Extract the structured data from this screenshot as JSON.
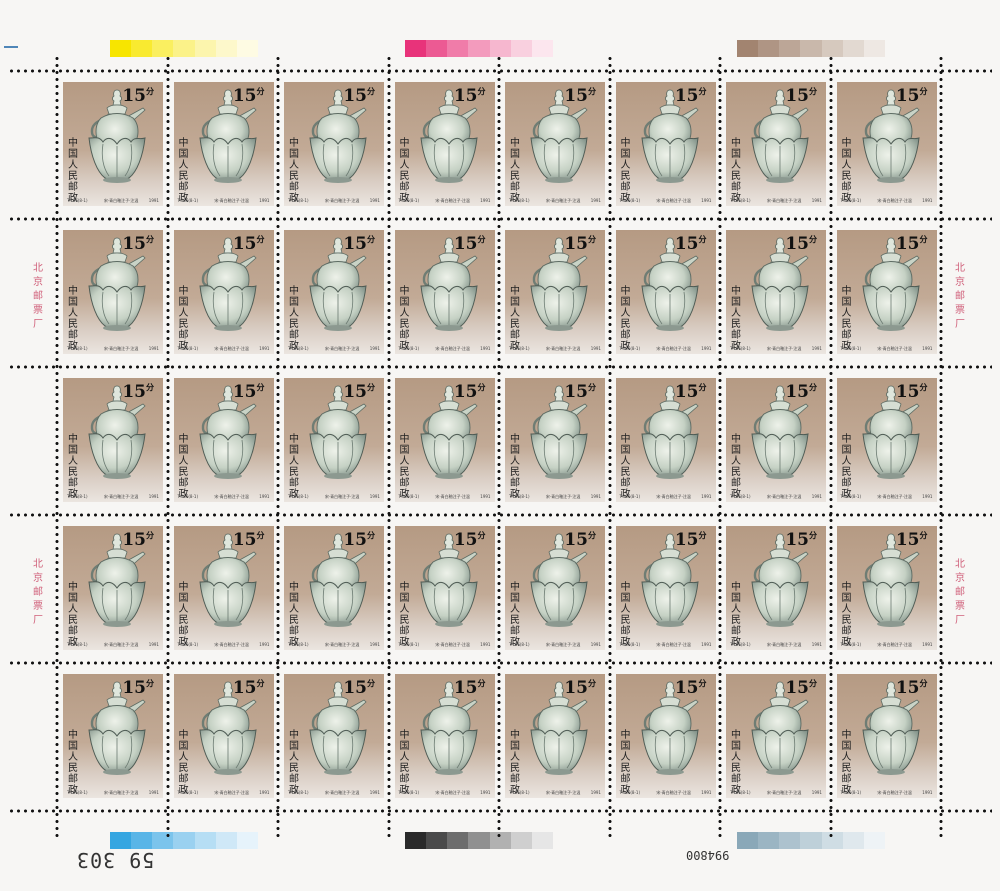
{
  "sheet": {
    "title": "",
    "rows": 5,
    "cols": 8
  },
  "stamp": {
    "denomination": "15",
    "denomination_unit": "分",
    "country": "中国人民邮政",
    "code": "T.166(8-1)",
    "description": "宋·青白釉注子·注温",
    "year": "1991",
    "colors": {
      "background_top": "#b59a83",
      "background_bottom": "#ebe5e0",
      "porcelain": "#c9d3c6"
    }
  },
  "margin": {
    "imprint": "北京邮票厂",
    "serial_left": "59 303",
    "serial_right": "994800"
  },
  "color_strips": [
    {
      "name": "yellow-strip",
      "colors": [
        "#f7e500",
        "#f9ea30",
        "#faef60",
        "#fbf289",
        "#fcf5ad",
        "#fdf8cb",
        "#fefbe3"
      ]
    },
    {
      "name": "magenta-strip",
      "colors": [
        "#e8337a",
        "#ec5a93",
        "#f07ca9",
        "#f39bbd",
        "#f6b7cf",
        "#f9d0df",
        "#fce6ee"
      ]
    },
    {
      "name": "brown-strip",
      "colors": [
        "#a28470",
        "#af9584",
        "#bca697",
        "#c9b8ab",
        "#d6c9be",
        "#e2d9d1",
        "#eee8e3"
      ]
    },
    {
      "name": "cyan-strip",
      "colors": [
        "#35a6e1",
        "#59b5e7",
        "#7bc4ec",
        "#9ad1f0",
        "#b6def4",
        "#cfe8f7",
        "#e6f3fb"
      ]
    },
    {
      "name": "black-strip",
      "colors": [
        "#2a2a2a",
        "#4a4a4a",
        "#6d6d6d",
        "#909090",
        "#b1b1b1",
        "#cfcfcf",
        "#e6e6e6"
      ]
    },
    {
      "name": "slate-strip",
      "colors": [
        "#8aa8b8",
        "#9bb5c3",
        "#adc2ce",
        "#bed0d9",
        "#cfdde4",
        "#dfe8ed",
        "#eef3f6"
      ]
    }
  ]
}
